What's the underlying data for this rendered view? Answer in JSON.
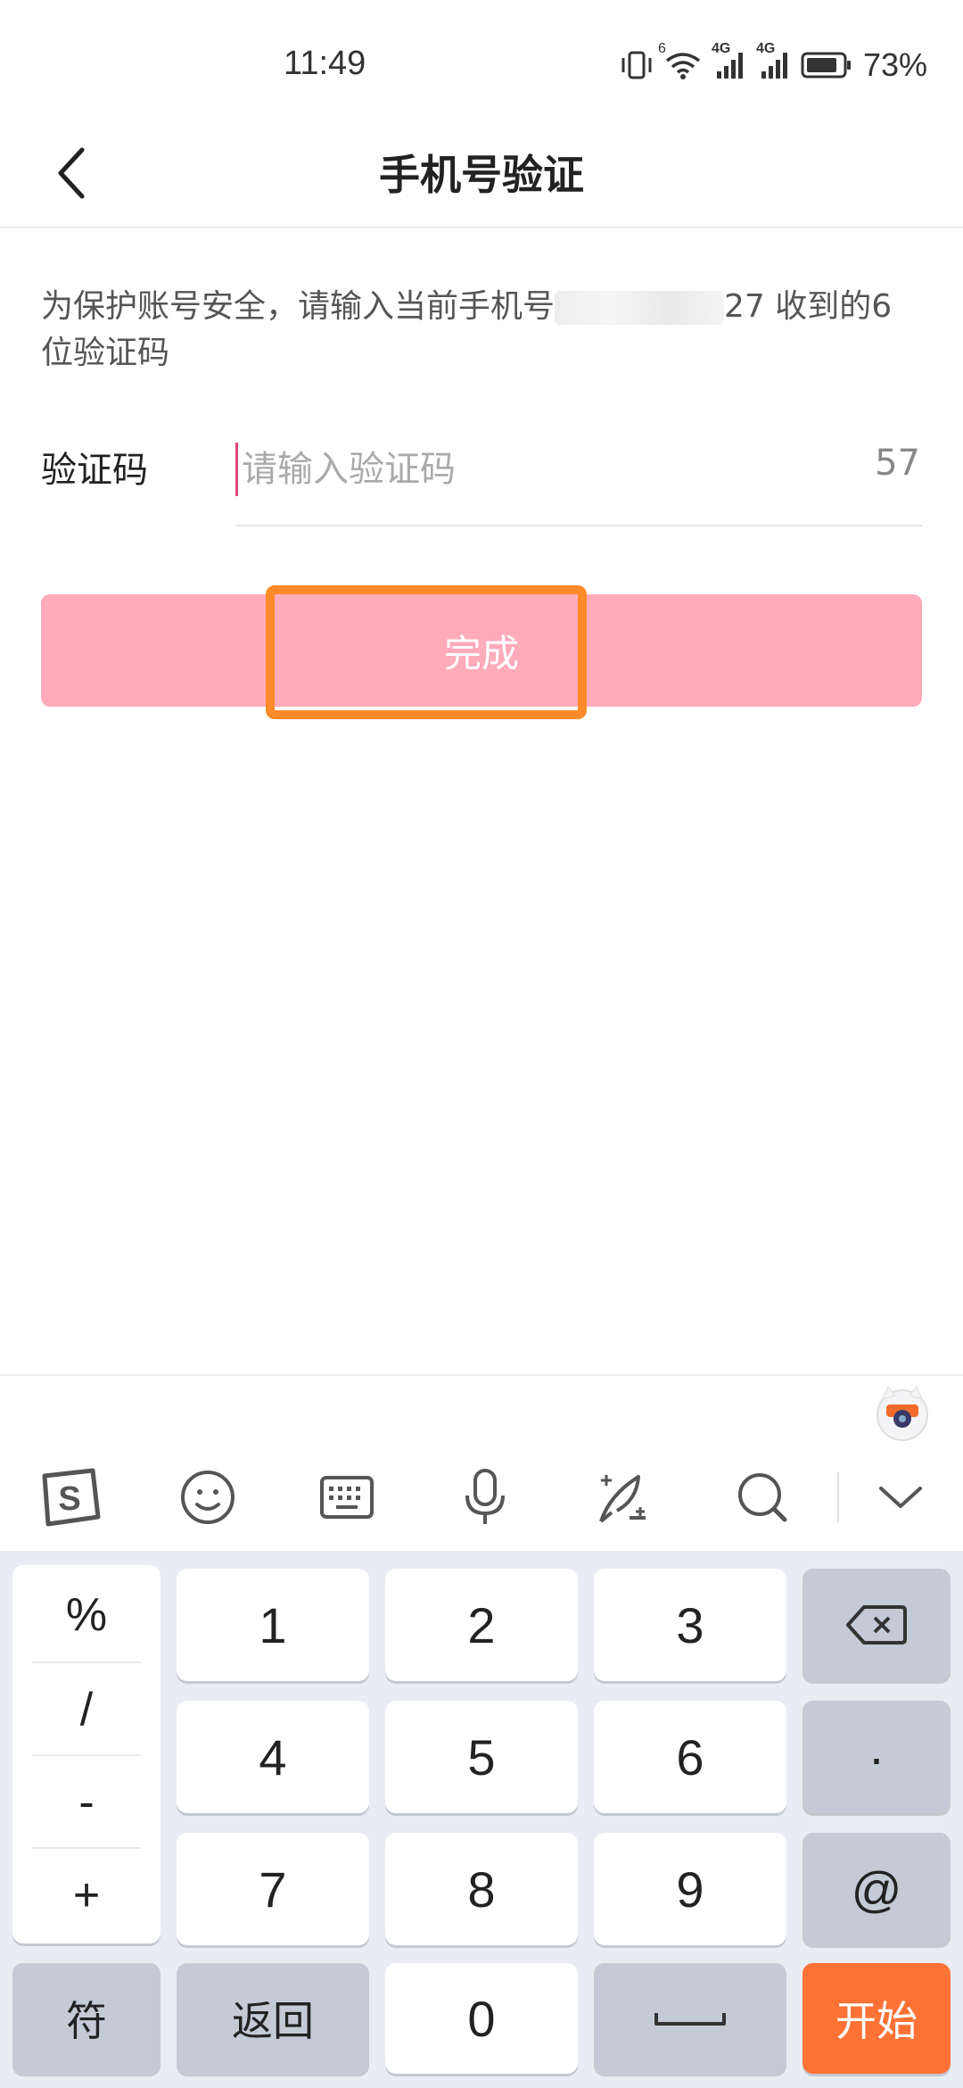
{
  "status_bar": {
    "time": "11:49",
    "network_1": "4G",
    "network_2": "4G",
    "wifi_tag": "6",
    "battery": "73%"
  },
  "header": {
    "title": "手机号验证",
    "back_icon": "chevron-left-icon"
  },
  "description": {
    "prefix": "为保护账号安全，请输入当前手机号",
    "suffix": "27 收到的6位验证码"
  },
  "form": {
    "code_label": "验证码",
    "code_placeholder": "请输入验证码",
    "countdown": "57"
  },
  "done_button": {
    "label": "完成",
    "color": "#ffabba",
    "highlight_color": "#ff8a2a"
  },
  "toolbar": {
    "items": [
      "sogou-logo-icon",
      "emoji-icon",
      "keyboard-icon",
      "microphone-icon",
      "handwriting-icon",
      "search-icon",
      "collapse-icon"
    ]
  },
  "keyboard": {
    "symbols": [
      "%",
      "/",
      "-",
      "+"
    ],
    "digits": [
      "1",
      "2",
      "3",
      "4",
      "5",
      "6",
      "7",
      "8",
      "9",
      "0"
    ],
    "right_keys": [
      "backspace-icon",
      "·",
      "@"
    ],
    "bottom": {
      "symbol_key": "符",
      "back_key": "返回",
      "space_key": "space-icon",
      "action_key": "开始"
    },
    "accent_color": "#fe7235"
  }
}
